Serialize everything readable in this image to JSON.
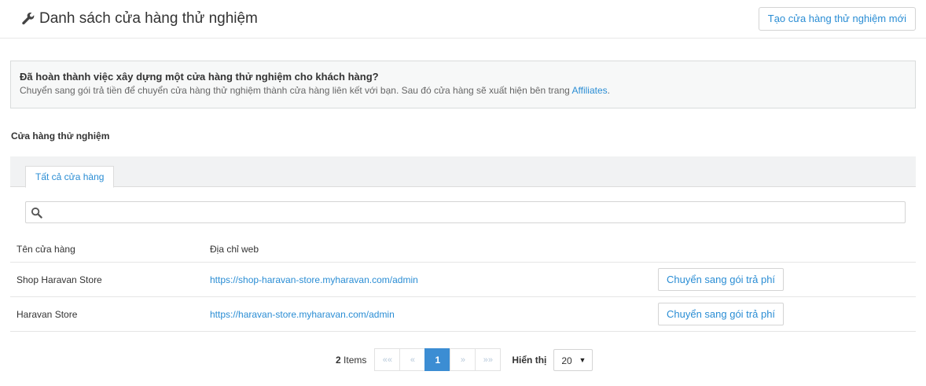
{
  "header": {
    "title": "Danh sách cửa hàng thử nghiệm",
    "create_button": "Tạo cửa hàng thử nghiệm mới"
  },
  "notice": {
    "title": "Đã hoàn thành việc xây dựng một cửa hàng thử nghiệm cho khách hàng?",
    "text": "Chuyển sang gói trả tiền để chuyển cửa hàng thử nghiệm thành cửa hàng liên kết với bạn. Sau đó cửa hàng sẽ xuất hiện bên trang ",
    "link": "Affiliates",
    "suffix": "."
  },
  "section": {
    "title": "Cửa hàng thử nghiệm"
  },
  "tabs": [
    {
      "label": "Tất cả cửa hàng"
    }
  ],
  "search": {
    "value": "",
    "placeholder": ""
  },
  "table": {
    "columns": [
      "Tên cửa hàng",
      "Địa chỉ web"
    ],
    "rows": [
      {
        "name": "Shop Haravan Store",
        "url": "https://shop-haravan-store.myharavan.com/admin",
        "action": "Chuyển sang gói trả phí"
      },
      {
        "name": "Haravan Store",
        "url": "https://haravan-store.myharavan.com/admin",
        "action": "Chuyển sang gói trả phí"
      }
    ]
  },
  "pagination": {
    "count": "2",
    "count_label": "Items",
    "first": "««",
    "prev": "«",
    "current": "1",
    "next": "»",
    "last": "»»",
    "show_label": "Hiển thị",
    "page_size": "20"
  },
  "icons": {
    "title_icon": "wrench-icon",
    "search_icon": "search-icon",
    "select_icon": "caret-down-icon"
  },
  "colors": {
    "accent": "#2a8dd4",
    "active_page": "#3c8dd3"
  }
}
